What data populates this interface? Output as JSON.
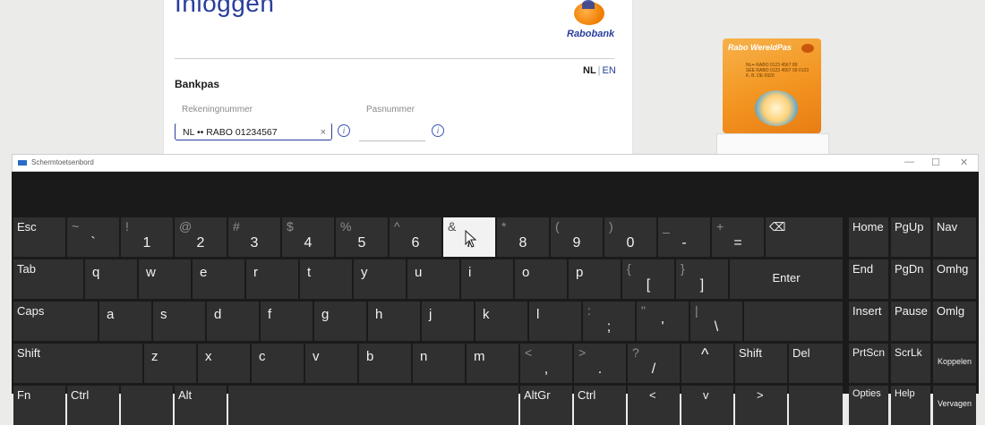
{
  "login": {
    "title": "Inloggen",
    "logo_text": "Rabobank",
    "lang_nl": "NL",
    "lang_sep": "|",
    "lang_en": "EN",
    "section_label": "Bankpas",
    "account_label": "Rekeningnummer",
    "account_value": "NL •• RABO 01234567",
    "clear_glyph": "×",
    "pasnummer_label": "Pasnummer",
    "pasnummer_value": "",
    "info_glyph": "i"
  },
  "card": {
    "title": "Rabo WereldPas",
    "chip_line1": "NL•• RABO 0123 4567 89",
    "chip_line2": "SEE RABO 0123 4567 09    0123",
    "chip_line3": "K. B. DE 0920"
  },
  "osk": {
    "window_title": "Schermtoetsenbord",
    "minimize": "—",
    "maximize": "☐",
    "close": "✕",
    "keys": {
      "esc": {
        "main": "Esc"
      },
      "tilde": {
        "shift": "~",
        "main": "`"
      },
      "n1": {
        "shift": "!",
        "main": "1"
      },
      "n2": {
        "shift": "@",
        "main": "2"
      },
      "n3": {
        "shift": "#",
        "main": "3"
      },
      "n4": {
        "shift": "$",
        "main": "4"
      },
      "n5": {
        "shift": "%",
        "main": "5"
      },
      "n6": {
        "shift": "^",
        "main": "6"
      },
      "n7": {
        "shift": "&",
        "main": "7"
      },
      "n8": {
        "shift": "*",
        "main": "8"
      },
      "n9": {
        "shift": "(",
        "main": "9"
      },
      "n0": {
        "shift": ")",
        "main": "0"
      },
      "minus": {
        "shift": "_",
        "main": "-"
      },
      "equals": {
        "shift": "+",
        "main": "="
      },
      "backspace": {
        "main": "⌫"
      },
      "home": {
        "main": "Home"
      },
      "pgup": {
        "main": "PgUp"
      },
      "nav": {
        "main": "Nav"
      },
      "tab": {
        "main": "Tab"
      },
      "q": {
        "main": "q"
      },
      "w": {
        "main": "w"
      },
      "e": {
        "main": "e"
      },
      "r": {
        "main": "r"
      },
      "t": {
        "main": "t"
      },
      "y": {
        "main": "y"
      },
      "u": {
        "main": "u"
      },
      "i": {
        "main": "i"
      },
      "o": {
        "main": "o"
      },
      "p": {
        "main": "p"
      },
      "lbracket": {
        "shift": "{",
        "main": "["
      },
      "rbracket": {
        "shift": "}",
        "main": "]"
      },
      "enter": {
        "main": "Enter"
      },
      "end": {
        "main": "End"
      },
      "pgdn": {
        "main": "PgDn"
      },
      "omhg": {
        "main": "Omhg"
      },
      "caps": {
        "main": "Caps"
      },
      "a": {
        "main": "a"
      },
      "s": {
        "main": "s"
      },
      "d": {
        "main": "d"
      },
      "f": {
        "main": "f"
      },
      "g": {
        "main": "g"
      },
      "h": {
        "main": "h"
      },
      "j": {
        "main": "j"
      },
      "k": {
        "main": "k"
      },
      "l": {
        "main": "l"
      },
      "semicolon": {
        "shift": ":",
        "main": ";"
      },
      "quote": {
        "shift": "\"",
        "main": "'"
      },
      "backslash": {
        "shift": "|",
        "main": "\\"
      },
      "insert": {
        "main": "Insert"
      },
      "pause": {
        "main": "Pause"
      },
      "omlg": {
        "main": "Omlg"
      },
      "lshift": {
        "main": "Shift"
      },
      "z": {
        "main": "z"
      },
      "x": {
        "main": "x"
      },
      "c": {
        "main": "c"
      },
      "v": {
        "main": "v"
      },
      "b": {
        "main": "b"
      },
      "n": {
        "main": "n"
      },
      "m": {
        "main": "m"
      },
      "comma": {
        "shift": "<",
        "main": ","
      },
      "period": {
        "shift": ">",
        "main": "."
      },
      "slash": {
        "shift": "?",
        "main": "/"
      },
      "uparrow": {
        "main": "^"
      },
      "rshift": {
        "main": "Shift"
      },
      "del": {
        "main": "Del"
      },
      "prtscn": {
        "main": "PrtScn"
      },
      "scrlk": {
        "main": "ScrLk"
      },
      "koppelen": {
        "main": "Koppelen"
      },
      "fn": {
        "main": "Fn"
      },
      "ctrl": {
        "main": "Ctrl"
      },
      "alt": {
        "main": "Alt"
      },
      "altgr": {
        "main": "AltGr"
      },
      "rctrl": {
        "main": "Ctrl"
      },
      "leftarrow": {
        "main": "<"
      },
      "downarrow": {
        "main": "v"
      },
      "rightarrow": {
        "main": ">"
      },
      "options": {
        "main": "Opties"
      },
      "help": {
        "main": "Help"
      },
      "vervagen": {
        "main": "Vervagen"
      }
    }
  }
}
